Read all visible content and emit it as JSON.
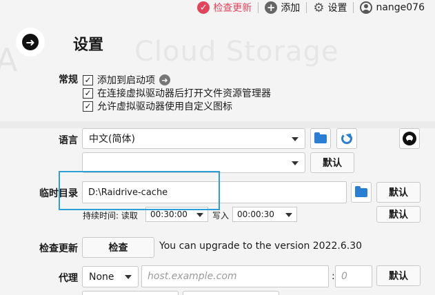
{
  "topbar": {
    "check_update": "检查更新",
    "add": "添加",
    "settings": "设置",
    "user": "nange076"
  },
  "background": {
    "watermark": "Cloud Storage"
  },
  "page": {
    "title": "设置"
  },
  "general": {
    "label": "常规",
    "options": [
      {
        "label": "添加到启动项",
        "checked": true
      },
      {
        "label": "在连接虚拟驱动器后打开文件资源管理器",
        "checked": true
      },
      {
        "label": "允许虚拟驱动器使用自定义图标",
        "checked": true
      }
    ]
  },
  "language": {
    "label": "语言",
    "selected": "中文(简体)",
    "secondary_selected": "",
    "default_label": "默认"
  },
  "temp_dir": {
    "label": "临时目录",
    "value": "D:\\Raidrive-cache",
    "default_label": "默认",
    "duration_label": "持续时间: 读取",
    "read_value": "00:30:00",
    "write_label": "写入",
    "write_value": "00:00:30",
    "duration_default_label": "默认"
  },
  "check_update": {
    "label": "检查更新",
    "button": "检查",
    "message": "You can upgrade to the version 2022.6.30"
  },
  "proxy": {
    "label": "代理",
    "type": "None",
    "host_placeholder": "host.example.com",
    "port_sep": ":",
    "port_placeholder": "0",
    "default_label": "默认"
  },
  "colors": {
    "accent_red": "#e0455c",
    "accent_blue": "#2a7fd4",
    "highlight": "#2b9fd6"
  }
}
